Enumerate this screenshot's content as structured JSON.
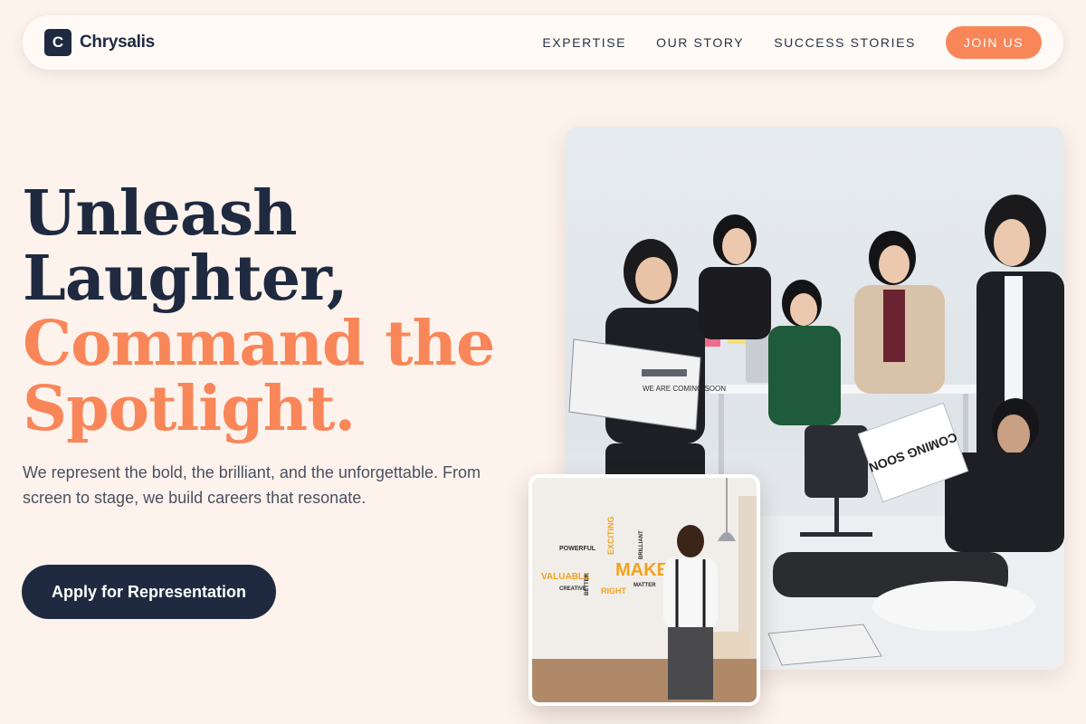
{
  "brand": {
    "logo_letter": "C",
    "name": "Chrysalis"
  },
  "nav": {
    "links": [
      "EXPERTISE",
      "OUR STORY",
      "SUCCESS STORIES"
    ],
    "cta_label": "JOIN US"
  },
  "hero": {
    "title_line1": "Unleash",
    "title_line2": "Laughter,",
    "title_line3": "Command the",
    "title_line4": "Spotlight.",
    "subtitle": "We represent the bold, the brilliant, and the unforgettable. From screen to stage, we build careers that resonate.",
    "cta_label": "Apply for Representation"
  },
  "photos": {
    "main": {
      "newspaper_text": "WE ARE COMING SOON",
      "sign_text": "COMING SOON"
    },
    "secondary": {
      "wall_words": [
        "MAKE IT",
        "POWERFUL",
        "VALUABLE",
        "EXCITING",
        "RIGHT",
        "BRILLIANT",
        "CREATIVE",
        "BETTER",
        "MATTER"
      ]
    }
  },
  "colors": {
    "background": "#fdf3ec",
    "navy": "#1f2a40",
    "accent": "#f98659"
  }
}
